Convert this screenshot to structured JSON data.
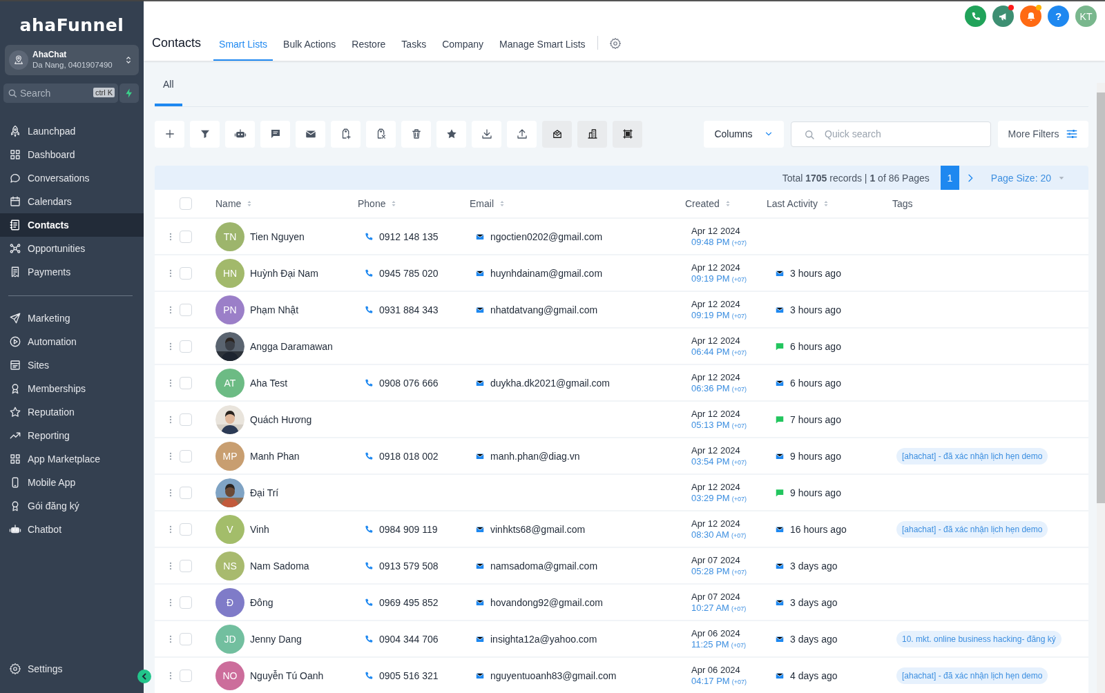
{
  "sidebar": {
    "logo": "ahaFunnel",
    "location": {
      "name": "AhaChat",
      "detail": "Da Nang, 0401907490"
    },
    "search": {
      "placeholder": "Search",
      "shortcut": "ctrl K"
    },
    "nav_groups": [
      {
        "items": [
          {
            "label": "Launchpad",
            "kind": "rocket",
            "selected": false
          },
          {
            "label": "Dashboard",
            "kind": "grid",
            "selected": false
          },
          {
            "label": "Conversations",
            "kind": "chat",
            "selected": false
          },
          {
            "label": "Calendars",
            "kind": "calendar",
            "selected": false
          },
          {
            "label": "Contacts",
            "kind": "contacts",
            "selected": true
          },
          {
            "label": "Opportunities",
            "kind": "network",
            "selected": false
          },
          {
            "label": "Payments",
            "kind": "receipt",
            "selected": false
          }
        ]
      },
      {
        "items": [
          {
            "label": "Marketing",
            "kind": "send",
            "selected": false
          },
          {
            "label": "Automation",
            "kind": "play",
            "selected": false
          },
          {
            "label": "Sites",
            "kind": "sites",
            "selected": false
          },
          {
            "label": "Memberships",
            "kind": "award",
            "selected": false
          },
          {
            "label": "Reputation",
            "kind": "star",
            "selected": false
          },
          {
            "label": "Reporting",
            "kind": "trend",
            "selected": false
          },
          {
            "label": "App Marketplace",
            "kind": "grid",
            "selected": false
          },
          {
            "label": "Mobile App",
            "kind": "mobile",
            "selected": false
          },
          {
            "label": "Gói đăng ký",
            "kind": "medal",
            "selected": false
          },
          {
            "label": "Chatbot",
            "kind": "robot",
            "selected": false
          }
        ]
      }
    ],
    "settings": {
      "label": "Settings"
    }
  },
  "header": {
    "title": "Contacts",
    "tabs": [
      {
        "label": "Smart Lists",
        "selected": true
      },
      {
        "label": "Bulk Actions",
        "selected": false
      },
      {
        "label": "Restore",
        "selected": false
      },
      {
        "label": "Tasks",
        "selected": false
      },
      {
        "label": "Company",
        "selected": false
      },
      {
        "label": "Manage Smart Lists",
        "selected": false
      }
    ],
    "top_buttons": [
      {
        "kind": "phone",
        "color": "#21a35a"
      },
      {
        "kind": "megaphone",
        "color": "#3d8f72",
        "badge": {
          "color": "#ff1a1a"
        }
      },
      {
        "kind": "bell",
        "color": "#ff6a13",
        "badge": {
          "color": "#ffb300"
        }
      },
      {
        "kind": "help",
        "color": "#1e88f0",
        "label": "?"
      },
      {
        "kind": "avatar",
        "color": "#79b78d",
        "label": "KT"
      }
    ]
  },
  "sub_tabs": [
    {
      "label": "All",
      "selected": true
    }
  ],
  "toolbar": [
    {
      "kind": "plus",
      "disabled": false
    },
    {
      "kind": "filter",
      "disabled": false
    },
    {
      "kind": "robot",
      "disabled": false
    },
    {
      "kind": "message",
      "disabled": false
    },
    {
      "kind": "mail",
      "disabled": false
    },
    {
      "kind": "tag-plus",
      "disabled": false
    },
    {
      "kind": "tag-x",
      "disabled": false
    },
    {
      "kind": "trash",
      "disabled": false
    },
    {
      "kind": "star",
      "disabled": false
    },
    {
      "kind": "download",
      "disabled": false
    },
    {
      "kind": "upload",
      "disabled": false
    },
    {
      "kind": "mail-check",
      "disabled": true
    },
    {
      "kind": "building",
      "disabled": true
    },
    {
      "kind": "frame",
      "disabled": true
    }
  ],
  "columns_button": "Columns",
  "quick_search": {
    "placeholder": "Quick search"
  },
  "more_filters": "More Filters",
  "pagination": {
    "summary": "Total **1705** records | **1** of 86 Pages",
    "current_page": "1",
    "page_size": "Page Size: 20"
  },
  "table": {
    "select_all": {
      "selected": false
    },
    "columns": [
      {
        "label": "Name",
        "sortable": true
      },
      {
        "label": "Phone",
        "sortable": true
      },
      {
        "label": "Email",
        "sortable": true
      },
      {
        "label": "Created",
        "sortable": true
      },
      {
        "label": "Last Activity",
        "sortable": true
      },
      {
        "label": "Tags",
        "sortable": false
      }
    ],
    "rows": [
      {
        "selected": false,
        "avatar": {
          "kind": "initials",
          "initials": "TN",
          "color": "#9db56c"
        },
        "name": "Tien Nguyen",
        "phone": "0912 148 135",
        "email": "ngoctien0202@gmail.com",
        "created_date": "Apr 12 2024",
        "created_time": "09:48 PM",
        "timezone": "(+07)"
      },
      {
        "selected": false,
        "avatar": {
          "kind": "initials",
          "initials": "HN",
          "color": "#a2b96b"
        },
        "name": "Huỳnh Đại Nam",
        "phone": "0945 785 020",
        "email": "huynhdainam@gmail.com",
        "created_date": "Apr 12 2024",
        "created_time": "09:19 PM",
        "timezone": "(+07)",
        "activity": {
          "kind": "email",
          "text": "3 hours ago"
        }
      },
      {
        "selected": false,
        "avatar": {
          "kind": "initials",
          "initials": "PN",
          "color": "#9b7fc8"
        },
        "name": "Phạm Nhật",
        "phone": "0931 884 343",
        "email": "nhatdatvang@gmail.com",
        "created_date": "Apr 12 2024",
        "created_time": "09:19 PM",
        "timezone": "(+07)",
        "activity": {
          "kind": "email",
          "text": "3 hours ago"
        }
      },
      {
        "selected": false,
        "name": "Angga Daramawan",
        "created_date": "Apr 12 2024",
        "created_time": "06:44 PM",
        "timezone": "(+07)",
        "activity": {
          "kind": "sms",
          "text": "6 hours ago"
        }
      },
      {
        "selected": false,
        "avatar": {
          "kind": "initials",
          "initials": "AT",
          "color": "#6cbb84"
        },
        "name": "Aha Test",
        "phone": "0908 076 666",
        "email": "duykha.dk2021@gmail.com",
        "created_date": "Apr 12 2024",
        "created_time": "06:36 PM",
        "timezone": "(+07)",
        "activity": {
          "kind": "email",
          "text": "6 hours ago"
        }
      },
      {
        "selected": false,
        "name": "Quách Hương",
        "created_date": "Apr 12 2024",
        "created_time": "05:13 PM",
        "timezone": "(+07)",
        "activity": {
          "kind": "sms",
          "text": "7 hours ago"
        }
      },
      {
        "selected": false,
        "avatar": {
          "kind": "initials",
          "initials": "MP",
          "color": "#c89e70"
        },
        "name": "Manh Phan",
        "phone": "0918 018 002",
        "email": "manh.phan@diag.vn",
        "created_date": "Apr 12 2024",
        "created_time": "03:54 PM",
        "timezone": "(+07)",
        "activity": {
          "kind": "email",
          "text": "9 hours ago"
        },
        "tag": "[ahachat] - đã xác nhận lịch hẹn demo"
      },
      {
        "selected": false,
        "name": "Đại Trí",
        "created_date": "Apr 12 2024",
        "created_time": "03:29 PM",
        "timezone": "(+07)",
        "activity": {
          "kind": "sms",
          "text": "9 hours ago"
        }
      },
      {
        "selected": false,
        "avatar": {
          "kind": "initials",
          "initials": "V",
          "color": "#a3bd6a"
        },
        "name": "Vinh",
        "phone": "0984 909 119",
        "email": "vinhkts68@gmail.com",
        "created_date": "Apr 12 2024",
        "created_time": "08:30 AM",
        "timezone": "(+07)",
        "activity": {
          "kind": "email",
          "text": "16 hours ago"
        },
        "tag": "[ahachat] - đã xác nhận lịch hẹn demo"
      },
      {
        "selected": false,
        "avatar": {
          "kind": "initials",
          "initials": "NS",
          "color": "#a8ba6e"
        },
        "name": "Nam Sadoma",
        "phone": "0913 579 508",
        "email": "namsadoma@gmail.com",
        "created_date": "Apr 07 2024",
        "created_time": "05:28 PM",
        "timezone": "(+07)",
        "activity": {
          "kind": "email",
          "text": "3 days ago"
        }
      },
      {
        "selected": false,
        "avatar": {
          "kind": "initials",
          "initials": "Đ",
          "color": "#7f7bc8"
        },
        "name": "Đông",
        "phone": "0969 495 852",
        "email": "hovandong92@gmail.com",
        "created_date": "Apr 07 2024",
        "created_time": "10:27 AM",
        "timezone": "(+07)",
        "activity": {
          "kind": "email",
          "text": "3 days ago"
        }
      },
      {
        "selected": false,
        "avatar": {
          "kind": "initials",
          "initials": "JD",
          "color": "#72bf9f"
        },
        "name": "Jenny Dang",
        "phone": "0904 344 706",
        "email": "insighta12a@yahoo.com",
        "created_date": "Apr 06 2024",
        "created_time": "11:25 PM",
        "timezone": "(+07)",
        "activity": {
          "kind": "email",
          "text": "3 days ago"
        },
        "tag": "10. mkt. online business hacking- đăng ký"
      },
      {
        "selected": false,
        "avatar": {
          "kind": "initials",
          "initials": "NO",
          "color": "#cc6d9b"
        },
        "name": "Nguyễn Tú Oanh",
        "phone": "0905 516 321",
        "email": "nguyentuoanh83@gmail.com",
        "created_date": "Apr 06 2024",
        "created_time": "04:17 PM",
        "timezone": "(+07)",
        "activity": {
          "kind": "email",
          "text": "4 days ago"
        },
        "tag": "[ahachat] - đã xác nhận lịch hẹn demo"
      }
    ]
  }
}
